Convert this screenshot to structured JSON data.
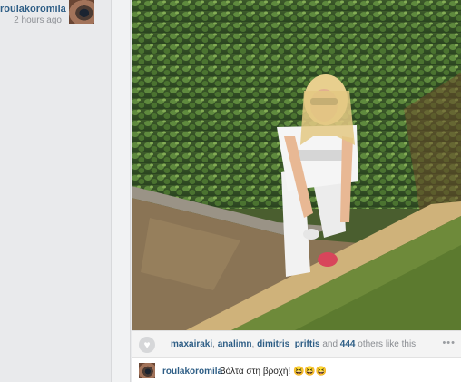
{
  "post": {
    "username": "roulakoromila",
    "time": "2 hours ago"
  },
  "likes": {
    "users": [
      "maxairaki",
      "analimn",
      "dimitris_priftis"
    ],
    "separator1": ", ",
    "separator2": ", ",
    "and_text": " and ",
    "count": "444",
    "suffix": " others like this.",
    "more_icon": "more-dots-icon",
    "heart_icon": "heart-icon"
  },
  "caption": {
    "username": "roulakoromila",
    "text": "Βόλτα στη βροχή! 😆😆😆"
  }
}
